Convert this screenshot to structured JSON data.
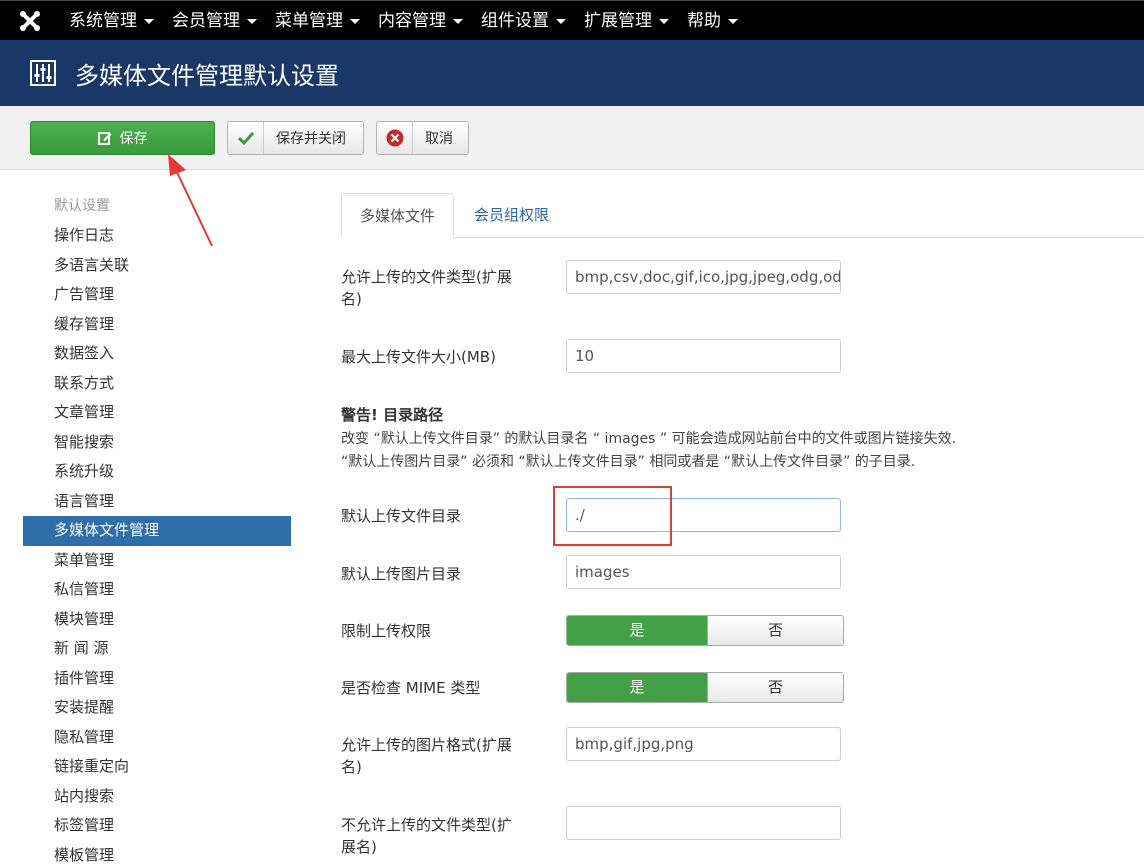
{
  "nav": {
    "items": [
      "系统管理",
      "会员管理",
      "菜单管理",
      "内容管理",
      "组件设置",
      "扩展管理",
      "帮助"
    ]
  },
  "header": {
    "title": "多媒体文件管理默认设置"
  },
  "toolbar": {
    "save": "保存",
    "save_close": "保存并关闭",
    "cancel": "取消"
  },
  "sidebar": {
    "header": "默认设置",
    "items": [
      "操作日志",
      "多语言关联",
      "广告管理",
      "缓存管理",
      "数据签入",
      "联系方式",
      "文章管理",
      "智能搜索",
      "系统升级",
      "语言管理",
      "多媒体文件管理",
      "菜单管理",
      "私信管理",
      "模块管理",
      "新 闻 源",
      "插件管理",
      "安装提醒",
      "隐私管理",
      "链接重定向",
      "站内搜索",
      "标签管理",
      "模板管理"
    ],
    "active_index": 10
  },
  "tabs": [
    "多媒体文件",
    "会员组权限"
  ],
  "form": {
    "upload_ext_label_1": "允许上传的文件类型(扩展",
    "upload_ext_label_2": "名)",
    "upload_ext_value": "bmp,csv,doc,gif,ico,jpg,jpeg,odg,odp",
    "max_size_label": "最大上传文件大小(MB)",
    "max_size_value": "10",
    "warning_title": "警告! 目录路径",
    "warning_line1": "改变 “默认上传文件目录” 的默认目录名 “ images ” 可能会造成网站前台中的文件或图片链接失效.",
    "warning_line2": "“默认上传图片目录” 必须和 “默认上传文件目录” 相同或者是 “默认上传文件目录” 的子目录.",
    "file_path_label": "默认上传文件目录",
    "file_path_value": "./",
    "image_path_label": "默认上传图片目录",
    "image_path_value": "images",
    "restrict_label": "限制上传权限",
    "check_mime_label": "是否检查 MIME 类型",
    "yes": "是",
    "no": "否",
    "image_ext_label_1": "允许上传的图片格式(扩展",
    "image_ext_label_2": "名)",
    "image_ext_value": "bmp,gif,jpg,png",
    "illegal_ext_label_1": "不允许上传的文件类型(扩",
    "illegal_ext_label_2": "展名)",
    "illegal_ext_value": ""
  },
  "colors": {
    "nav_bg": "#000000",
    "header_bg": "#1a3867",
    "save_green": "#43a047",
    "active_blue": "#2f6ea8",
    "annotation_red": "#e53935"
  }
}
